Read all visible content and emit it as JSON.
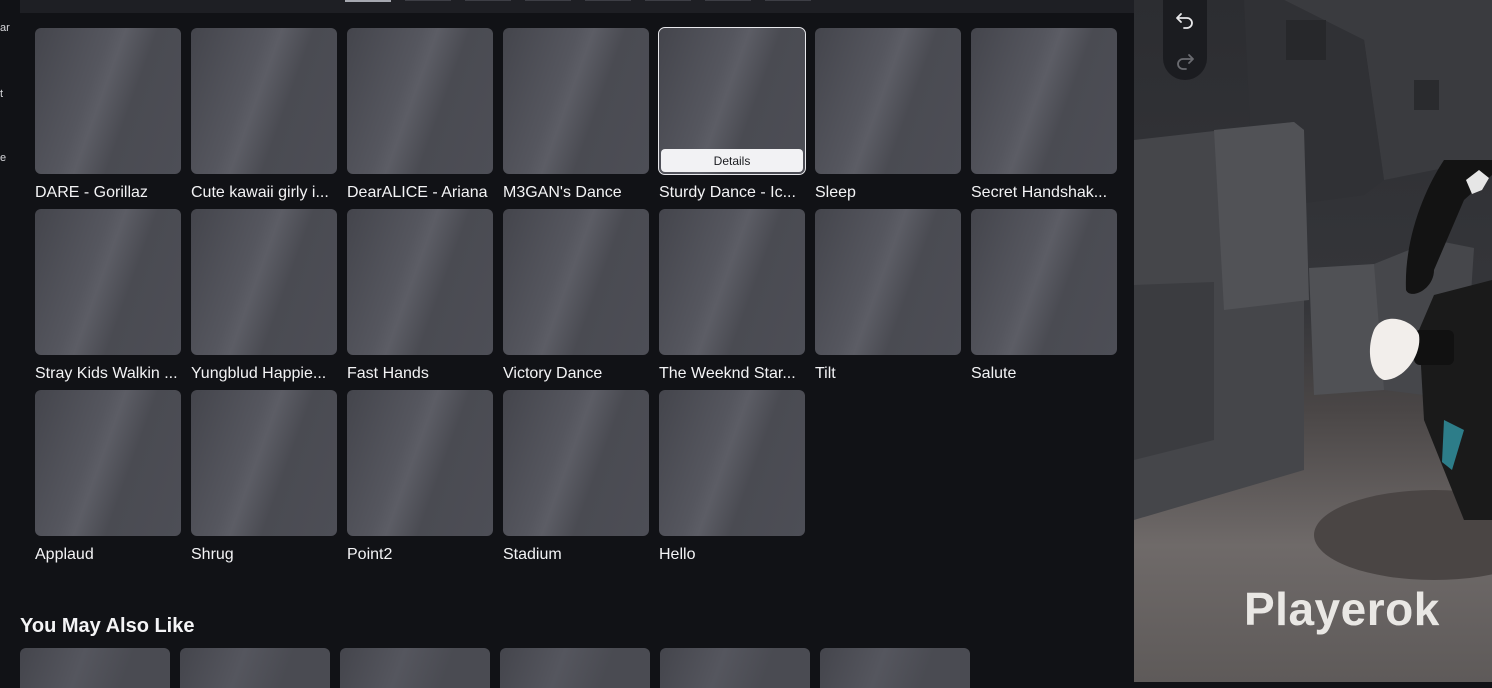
{
  "left_edge_fragments": [
    "ar",
    "t",
    "e"
  ],
  "top_tabs_count": 8,
  "items": [
    {
      "name": "DARE - Gorillaz"
    },
    {
      "name": "Cute kawaii girly i..."
    },
    {
      "name": "DearALICE - Ariana"
    },
    {
      "name": "M3GAN's Dance"
    },
    {
      "name": "Sturdy Dance - Ic...",
      "selected": true,
      "details_label": "Details"
    },
    {
      "name": "Sleep"
    },
    {
      "name": "Secret Handshak..."
    },
    {
      "name": "Stray Kids Walkin ..."
    },
    {
      "name": "Yungblud Happie..."
    },
    {
      "name": "Fast Hands"
    },
    {
      "name": "Victory Dance"
    },
    {
      "name": "The Weeknd Star..."
    },
    {
      "name": "Tilt"
    },
    {
      "name": "Salute"
    },
    {
      "name": "Applaud"
    },
    {
      "name": "Shrug"
    },
    {
      "name": "Point2"
    },
    {
      "name": "Stadium"
    },
    {
      "name": "Hello"
    }
  ],
  "recommendations": {
    "title": "You May Also Like",
    "card_count": 6
  },
  "viewport": {
    "undo_icon": "undo-icon",
    "redo_icon": "redo-icon",
    "watermark": "Playerok"
  }
}
